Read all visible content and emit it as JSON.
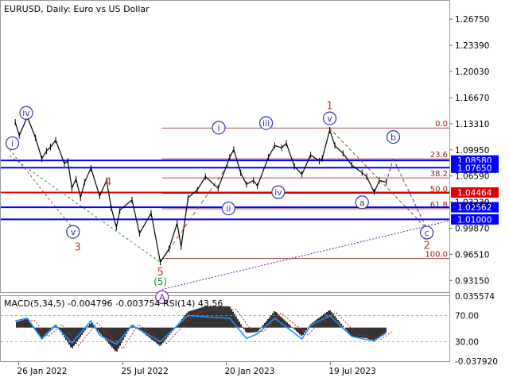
{
  "header": {
    "symbol_info": "EURUSD, Daily:  Euro vs US Dollar"
  },
  "indicator": {
    "label": "MACD(5,34,5) -0.004796 -0.003754 RSI(14) 43.56"
  },
  "chart_data": [
    {
      "type": "line",
      "title": "EURUSD, Daily:  Euro vs US Dollar",
      "ylim": [
        0.9165,
        1.2912
      ],
      "yticks": [
        "1.26750",
        "1.23390",
        "1.20030",
        "1.16670",
        "1.13310",
        "1.09950",
        "1.06590",
        "1.03230",
        "0.99870",
        "0.96510",
        "0.93150"
      ],
      "xticks": [
        "26 Jan 2022",
        "25 Jul 2022",
        "20 Jan 2023",
        "19 Jul 2023"
      ],
      "price_series": [
        {
          "x": "2022-01-20",
          "y": 1.135
        },
        {
          "x": "2022-01-27",
          "y": 1.118
        },
        {
          "x": "2022-02-10",
          "y": 1.142
        },
        {
          "x": "2022-02-24",
          "y": 1.115
        },
        {
          "x": "2022-03-07",
          "y": 1.088
        },
        {
          "x": "2022-03-15",
          "y": 1.098
        },
        {
          "x": "2022-03-22",
          "y": 1.103
        },
        {
          "x": "2022-03-31",
          "y": 1.112
        },
        {
          "x": "2022-04-15",
          "y": 1.082
        },
        {
          "x": "2022-04-21",
          "y": 1.085
        },
        {
          "x": "2022-04-28",
          "y": 1.05
        },
        {
          "x": "2022-05-05",
          "y": 1.062
        },
        {
          "x": "2022-05-13",
          "y": 1.038
        },
        {
          "x": "2022-05-20",
          "y": 1.058
        },
        {
          "x": "2022-05-31",
          "y": 1.076
        },
        {
          "x": "2022-06-15",
          "y": 1.04
        },
        {
          "x": "2022-06-27",
          "y": 1.06
        },
        {
          "x": "2022-07-05",
          "y": 1.025
        },
        {
          "x": "2022-07-14",
          "y": 1.0
        },
        {
          "x": "2022-07-20",
          "y": 1.022
        },
        {
          "x": "2022-08-10",
          "y": 1.035
        },
        {
          "x": "2022-08-23",
          "y": 0.992
        },
        {
          "x": "2022-09-12",
          "y": 1.018
        },
        {
          "x": "2022-09-28",
          "y": 0.955
        },
        {
          "x": "2022-10-13",
          "y": 0.972
        },
        {
          "x": "2022-10-27",
          "y": 1.005
        },
        {
          "x": "2022-11-03",
          "y": 0.975
        },
        {
          "x": "2022-11-15",
          "y": 1.038
        },
        {
          "x": "2022-12-01",
          "y": 1.048
        },
        {
          "x": "2022-12-15",
          "y": 1.065
        },
        {
          "x": "2023-01-06",
          "y": 1.05
        },
        {
          "x": "2023-01-26",
          "y": 1.09
        },
        {
          "x": "2023-02-02",
          "y": 1.1
        },
        {
          "x": "2023-02-14",
          "y": 1.07
        },
        {
          "x": "2023-02-24",
          "y": 1.055
        },
        {
          "x": "2023-03-08",
          "y": 1.06
        },
        {
          "x": "2023-03-15",
          "y": 1.053
        },
        {
          "x": "2023-04-03",
          "y": 1.09
        },
        {
          "x": "2023-04-14",
          "y": 1.105
        },
        {
          "x": "2023-04-26",
          "y": 1.102
        },
        {
          "x": "2023-05-04",
          "y": 1.108
        },
        {
          "x": "2023-05-18",
          "y": 1.078
        },
        {
          "x": "2023-05-31",
          "y": 1.068
        },
        {
          "x": "2023-06-15",
          "y": 1.093
        },
        {
          "x": "2023-06-30",
          "y": 1.085
        },
        {
          "x": "2023-07-05",
          "y": 1.088
        },
        {
          "x": "2023-07-18",
          "y": 1.125
        },
        {
          "x": "2023-07-27",
          "y": 1.105
        },
        {
          "x": "2023-08-10",
          "y": 1.095
        },
        {
          "x": "2023-08-25",
          "y": 1.08
        },
        {
          "x": "2023-09-12",
          "y": 1.07
        },
        {
          "x": "2023-09-20",
          "y": 1.065
        },
        {
          "x": "2023-10-03",
          "y": 1.045
        },
        {
          "x": "2023-10-12",
          "y": 1.06
        },
        {
          "x": "2023-10-24",
          "y": 1.058
        }
      ],
      "horizontal_levels": [
        {
          "label": "1.08580",
          "value": 1.0858,
          "color": "#0000ff"
        },
        {
          "label": "1.07650",
          "value": 1.0765,
          "color": "#0000ff"
        },
        {
          "label": "1.04464",
          "value": 1.04464,
          "color": "#e00000"
        },
        {
          "label": "1.02562",
          "value": 1.02562,
          "color": "#0000ff"
        },
        {
          "label": "1.01000",
          "value": 1.01,
          "color": "#0000ff"
        }
      ],
      "fibonacci_levels": [
        {
          "label": "0.0",
          "value": 1.1276
        },
        {
          "label": "23.6",
          "value": 1.0879
        },
        {
          "label": "38.2",
          "value": 1.0634
        },
        {
          "label": "50.0",
          "value": 1.0435
        },
        {
          "label": "61.8",
          "value": 1.0237
        },
        {
          "label": "100.0",
          "value": 0.9597
        }
      ],
      "wave_labels": [
        {
          "text": "iv",
          "style": "circle",
          "color": "#3333aa",
          "x": "2022-02-08",
          "y": 1.147
        },
        {
          "text": "i",
          "style": "circle",
          "color": "#3333aa",
          "x": "2022-01-15",
          "y": 1.108
        },
        {
          "text": "v",
          "style": "circle",
          "color": "#3333aa",
          "x": "2022-04-30",
          "y": 0.994
        },
        {
          "text": "4",
          "style": "plain",
          "color": "#b0402a",
          "x": "2022-06-30",
          "y": 1.058
        },
        {
          "text": "3",
          "style": "plain",
          "color": "#b0402a",
          "x": "2022-05-08",
          "y": 0.974
        },
        {
          "text": "5",
          "style": "plain",
          "color": "#b0402a",
          "x": "2022-09-28",
          "y": 0.942
        },
        {
          "text": "5",
          "style": "paren",
          "color": "#228822",
          "x": "2022-09-28",
          "y": 0.93
        },
        {
          "text": "A",
          "style": "circle",
          "color": "#7722aa",
          "x": "2022-10-01",
          "y": 0.91
        },
        {
          "text": "i",
          "style": "circle",
          "color": "#3333aa",
          "x": "2023-01-07",
          "y": 1.128
        },
        {
          "text": "ii",
          "style": "circle",
          "color": "#3333aa",
          "x": "2023-01-24",
          "y": 1.024
        },
        {
          "text": "iii",
          "style": "circle",
          "color": "#3333aa",
          "x": "2023-03-30",
          "y": 1.134
        },
        {
          "text": "iv",
          "style": "circle",
          "color": "#3333aa",
          "x": "2023-04-20",
          "y": 1.045
        },
        {
          "text": "1",
          "style": "plain",
          "color": "#b0402a",
          "x": "2023-07-18",
          "y": 1.156
        },
        {
          "text": "v",
          "style": "circle",
          "color": "#3333aa",
          "x": "2023-07-18",
          "y": 1.14
        },
        {
          "text": "a",
          "style": "circle",
          "color": "#3333aa",
          "x": "2023-09-12",
          "y": 1.032
        },
        {
          "text": "b",
          "style": "circle",
          "color": "#3333aa",
          "x": "2023-11-05",
          "y": 1.116
        },
        {
          "text": "c",
          "style": "circle",
          "color": "#3333aa",
          "x": "2024-01-02",
          "y": 0.993
        },
        {
          "text": "2",
          "style": "plain",
          "color": "#b0402a",
          "x": "2024-01-02",
          "y": 0.976
        }
      ]
    },
    {
      "type": "line",
      "title": "MACD(5,34,5) -0.004796 -0.003754 RSI(14) 43.56",
      "yticks": [
        "0.035574",
        "70.00",
        "30.00",
        "-0.037920"
      ],
      "ylim": [
        -0.03792,
        0.035574
      ],
      "macd_series": [
        {
          "x": "2022-01-20",
          "y": 0.006
        },
        {
          "x": "2022-02-10",
          "y": 0.01
        },
        {
          "x": "2022-03-07",
          "y": -0.012
        },
        {
          "x": "2022-03-31",
          "y": 0.004
        },
        {
          "x": "2022-04-28",
          "y": -0.024
        },
        {
          "x": "2022-05-31",
          "y": 0.006
        },
        {
          "x": "2022-06-15",
          "y": -0.006
        },
        {
          "x": "2022-07-14",
          "y": -0.028
        },
        {
          "x": "2022-08-10",
          "y": 0.004
        },
        {
          "x": "2022-09-28",
          "y": -0.021
        },
        {
          "x": "2022-11-15",
          "y": 0.018
        },
        {
          "x": "2022-12-15",
          "y": 0.024
        },
        {
          "x": "2023-01-26",
          "y": 0.024
        },
        {
          "x": "2023-02-24",
          "y": -0.006
        },
        {
          "x": "2023-03-15",
          "y": -0.005
        },
        {
          "x": "2023-04-14",
          "y": 0.019
        },
        {
          "x": "2023-05-31",
          "y": -0.01
        },
        {
          "x": "2023-06-15",
          "y": 0.004
        },
        {
          "x": "2023-07-18",
          "y": 0.02
        },
        {
          "x": "2023-08-25",
          "y": -0.01
        },
        {
          "x": "2023-09-20",
          "y": -0.012
        },
        {
          "x": "2023-10-03",
          "y": -0.016
        },
        {
          "x": "2023-10-24",
          "y": -0.004796
        }
      ],
      "rsi_series": [
        {
          "x": "2022-01-20",
          "y": 62
        },
        {
          "x": "2022-02-10",
          "y": 66
        },
        {
          "x": "2022-03-07",
          "y": 34
        },
        {
          "x": "2022-03-31",
          "y": 55
        },
        {
          "x": "2022-04-28",
          "y": 28
        },
        {
          "x": "2022-05-31",
          "y": 62
        },
        {
          "x": "2022-06-15",
          "y": 40
        },
        {
          "x": "2022-07-14",
          "y": 26
        },
        {
          "x": "2022-08-10",
          "y": 55
        },
        {
          "x": "2022-09-28",
          "y": 30
        },
        {
          "x": "2022-11-15",
          "y": 70
        },
        {
          "x": "2022-12-15",
          "y": 68
        },
        {
          "x": "2023-01-26",
          "y": 66
        },
        {
          "x": "2023-02-24",
          "y": 35
        },
        {
          "x": "2023-03-15",
          "y": 42
        },
        {
          "x": "2023-04-14",
          "y": 66
        },
        {
          "x": "2023-05-31",
          "y": 34
        },
        {
          "x": "2023-06-15",
          "y": 55
        },
        {
          "x": "2023-07-18",
          "y": 70
        },
        {
          "x": "2023-08-25",
          "y": 38
        },
        {
          "x": "2023-09-20",
          "y": 33
        },
        {
          "x": "2023-10-03",
          "y": 32
        },
        {
          "x": "2023-10-24",
          "y": 43.56
        }
      ]
    }
  ]
}
